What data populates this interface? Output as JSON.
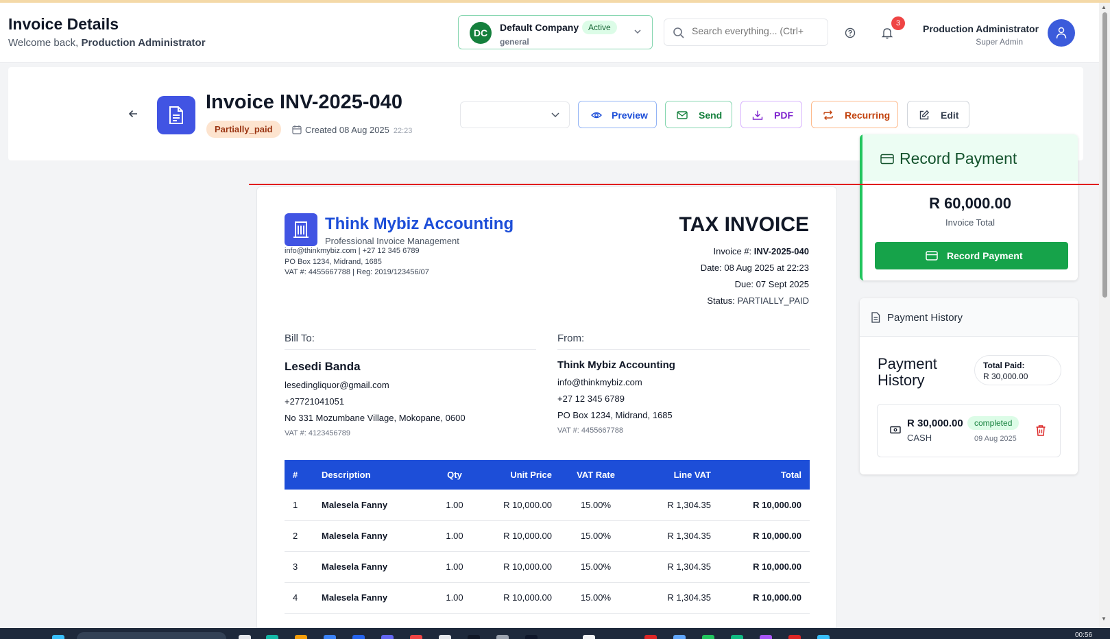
{
  "header": {
    "title": "Invoice Details",
    "welcome_prefix": "Welcome back, ",
    "welcome_user": "Production Administrator"
  },
  "company": {
    "initials": "DC",
    "name": "Default Company",
    "status": "Active",
    "type": "general"
  },
  "search": {
    "placeholder": "Search everything... (Ctrl+"
  },
  "notifications": {
    "count": "3"
  },
  "user": {
    "name": "Production Administrator",
    "role": "Super Admin"
  },
  "invoice": {
    "title": "Invoice INV-2025-040",
    "status": "Partially_paid",
    "created": "Created 08 Aug 2025",
    "created_time": "22:23"
  },
  "actions": {
    "preview": "Preview",
    "send": "Send",
    "pdf": "PDF",
    "recurring": "Recurring",
    "edit": "Edit"
  },
  "document": {
    "business_name": "Think Mybiz Accounting",
    "tagline": "Professional Invoice Management",
    "contact_line": "info@thinkmybiz.com | +27 12 345 6789",
    "address_line": "PO Box 1234, Midrand, 1685",
    "reg_line": "VAT #: 4455667788 | Reg: 2019/123456/07",
    "heading": "TAX INVOICE",
    "invoice_no_label": "Invoice #: ",
    "invoice_no": "INV-2025-040",
    "date": "Date: 08 Aug 2025 at 22:23",
    "due": "Due: 07 Sept 2025",
    "status_label": "Status: ",
    "status_value": "PARTIALLY_PAID",
    "bill_to": {
      "heading": "Bill To:",
      "name": "Lesedi Banda",
      "email": "lesedingliquor@gmail.com",
      "phone": "+27721041051",
      "address": "No 331 Mozumbane Village, Mokopane, 0600",
      "vat": "VAT #: 4123456789"
    },
    "from": {
      "heading": "From:",
      "name": "Think Mybiz Accounting",
      "email": "info@thinkmybiz.com",
      "phone": "+27 12 345 6789",
      "address": "PO Box 1234, Midrand, 1685",
      "vat": "VAT #: 4455667788"
    },
    "columns": [
      "#",
      "Description",
      "Qty",
      "Unit Price",
      "VAT Rate",
      "Line VAT",
      "Total"
    ],
    "rows": [
      [
        "1",
        "Malesela Fanny",
        "1.00",
        "R 10,000.00",
        "15.00%",
        "R 1,304.35",
        "R 10,000.00"
      ],
      [
        "2",
        "Malesela Fanny",
        "1.00",
        "R 10,000.00",
        "15.00%",
        "R 1,304.35",
        "R 10,000.00"
      ],
      [
        "3",
        "Malesela Fanny",
        "1.00",
        "R 10,000.00",
        "15.00%",
        "R 1,304.35",
        "R 10,000.00"
      ],
      [
        "4",
        "Malesela Fanny",
        "1.00",
        "R 10,000.00",
        "15.00%",
        "R 1,304.35",
        "R 10,000.00"
      ]
    ]
  },
  "record_payment": {
    "title": "Record Payment",
    "amount": "R 60,000.00",
    "amount_label": "Invoice Total",
    "button": "Record Payment"
  },
  "payment_history": {
    "card_title": "Payment History",
    "heading": "Payment History",
    "total_paid_label": "Total Paid:",
    "total_paid_value": "R 30,000.00",
    "entries": [
      {
        "amount": "R 30,000.00",
        "method": "CASH",
        "status": "completed",
        "date": "09 Aug 2025"
      }
    ]
  },
  "taskbar": {
    "clock": "00:56"
  }
}
